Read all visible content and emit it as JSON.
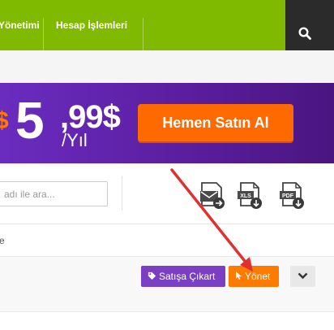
{
  "nav": {
    "item1_label": "Yönetimi",
    "item2_label": "Hesap İşlemleri",
    "search_icon": "search-icon"
  },
  "banner": {
    "currency_left": "$",
    "price_integer": "5",
    "price_decimal": ",99$",
    "period": "/Yıl",
    "buy_button_label": "Hemen Satın Al",
    "accent_color": "#ff6a00",
    "background_color": "#5b1e9f"
  },
  "toolbar": {
    "search_placeholder": "adı ile ara...",
    "export_icons": [
      "mail-export-icon",
      "xls-download-icon",
      "pdf-download-icon"
    ],
    "xls_label": "XLS",
    "pdf_label": "PDF"
  },
  "list": {
    "row1_label": "e",
    "sale_button_label": "Satışa Çıkart",
    "manage_button_label": "Yönet",
    "sale_button_color": "#7b3fc4",
    "manage_button_color": "#ff7a00"
  }
}
